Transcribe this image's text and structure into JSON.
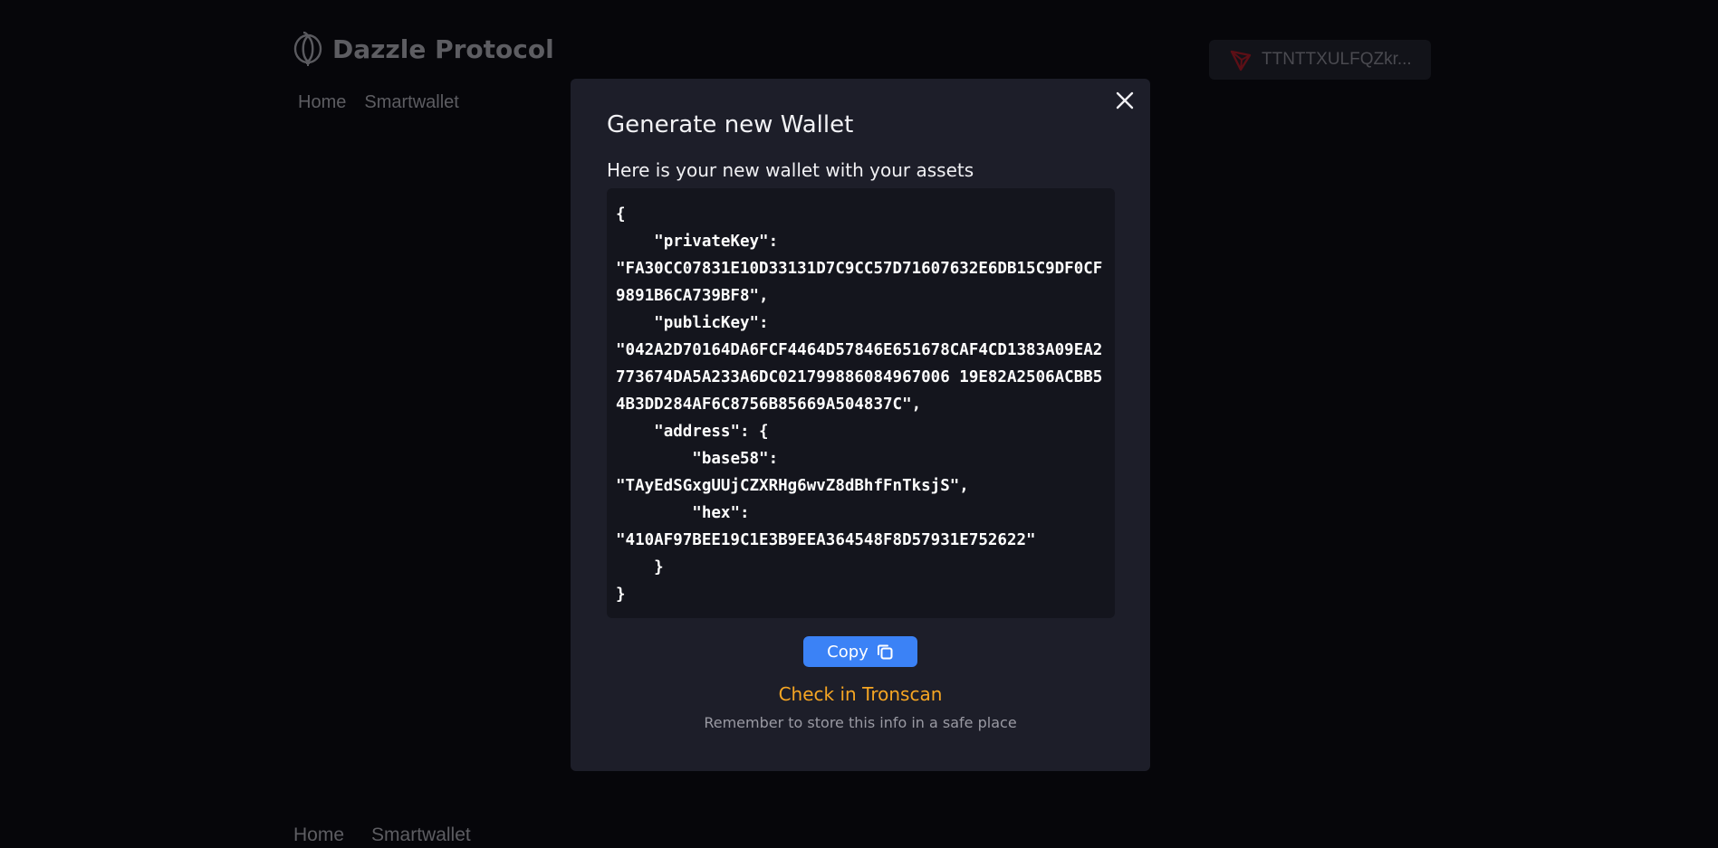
{
  "header": {
    "brand": "Dazzle Protocol",
    "logo_icon": "fruit-logo-icon"
  },
  "nav": {
    "items": [
      {
        "label": "Home"
      },
      {
        "label": "Smartwallet"
      }
    ]
  },
  "footer_nav": {
    "items": [
      {
        "label": "Home"
      },
      {
        "label": "Smartwallet"
      }
    ]
  },
  "wallet_chip": {
    "address": "TTNTTXULFQZkr...",
    "icon": "tron-icon",
    "icon_color": "#5c0f16"
  },
  "modal": {
    "title": "Generate new Wallet",
    "subtitle": "Here is your new wallet with your assets",
    "wallet_json": "{\n    \"privateKey\":\n\"FA30CC07831E10D33131D7C9CC57D71607632E6DB15C9DF0CF9891B6CA739BF8\",\n    \"publicKey\":\n\"042A2D70164DA6FCF4464D57846E651678CAF4CD1383A09EA2773674DA5A233A6DC021799886084967006 19E82A2506ACBB54B3DD284AF6C8756B85669A504837C\",\n    \"address\": {\n        \"base58\":\n\"TAyEdSGxgUUjCZXRHg6wvZ8dBhfFnTksjS\",\n        \"hex\":\n\"410AF97BEE19C1E3B9EEA364548F8D57931E752622\"\n    }\n}",
    "copy_label": "Copy",
    "copy_icon": "copy-icon",
    "tronscan_label": "Check in Tronscan",
    "note": "Remember to store this info in a safe place",
    "close_icon": "close-icon"
  },
  "colors": {
    "accent_blue": "#3b82f6",
    "link_orange": "#f6a623",
    "modal_bg": "#1d1e29",
    "code_bg": "#14151d"
  }
}
